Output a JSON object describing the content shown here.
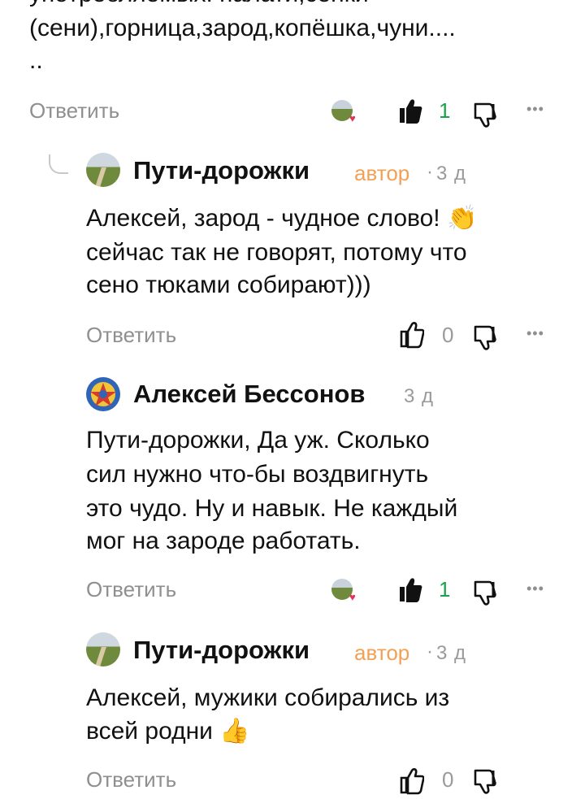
{
  "top_comment": {
    "line_partial": "употребляемых: палати,сенки",
    "line2": "(сени),горница,зарод,копёшка,чуни....",
    "line3": "..",
    "reply_label": "Ответить",
    "likes": "1",
    "liked": true
  },
  "comments": [
    {
      "author": "Пути-дорожки",
      "badge": "автор",
      "dot": "·",
      "time": "3 д",
      "lines": [
        "Алексей, зарод - чудное слово!",
        "сейчас так не говорят, потому что",
        "сено тюками собирают)))"
      ],
      "emoji": "👏",
      "reply_label": "Ответить",
      "likes": "0",
      "liked": false
    },
    {
      "author": "Алексей Бессонов",
      "time": "3 д",
      "lines": [
        "Пути-дорожки, Да уж. Сколько",
        "сил нужно что-бы воздвигнуть",
        "это чудо. Ну и навык. Не каждый",
        "мог на зароде работать."
      ],
      "reply_label": "Ответить",
      "likes": "1",
      "liked": true
    },
    {
      "author": "Пути-дорожки",
      "badge": "автор",
      "dot": "·",
      "time": "3 д",
      "lines": [
        "Алексей, мужики собирались из",
        "всей родни"
      ],
      "emoji": "👍",
      "reply_label": "Ответить",
      "likes": "0",
      "liked": false
    }
  ],
  "icons": {
    "like": "thumbs-up-icon",
    "dislike": "thumbs-down-icon",
    "more": "more-icon",
    "thread": "thread-line-icon",
    "author_like": "author-like-icon"
  },
  "colors": {
    "author_badge": "#f2a055",
    "like_count_active": "#1aa34a",
    "heart": "#e4345b"
  }
}
